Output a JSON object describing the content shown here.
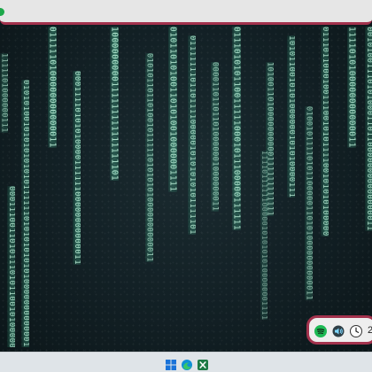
{
  "wallpaper": {
    "name": "binary-rain",
    "text_color": "#bff5dd",
    "glow_color": "#5fe0b0",
    "columns": [
      {
        "text": "0111110100000000000011"
      },
      {
        "text": "0101010010101010101011111101010101010100000000000011"
      },
      {
        "text": "1111101000000111"
      },
      {
        "text": "0001111010101000011111100000000000011"
      },
      {
        "text": "1000000000111111111111111101"
      },
      {
        "text": "010101101101001011111010101010000000000011"
      },
      {
        "text": "010110101001101010010000001111"
      },
      {
        "text": "01111111011011110000010101010101111101"
      },
      {
        "text": "000011011011010000001000000011"
      },
      {
        "text": "0111010101100111110001011100000111111"
      },
      {
        "text": "1010011010000000000111111111111"
      },
      {
        "text": "111101111110000010101010100000001111"
      },
      {
        "text": "1010110010101000000101010000111"
      },
      {
        "text": "010010111101011000001101010000000000011"
      },
      {
        "text": "0111011000100111001010111100101010100000"
      },
      {
        "text": "1111010100000000000011"
      },
      {
        "text": "001010011101010001101100000000000000011"
      },
      {
        "text": "000111001101011101011001010000000011"
      }
    ]
  },
  "top_bar": {
    "accent_color": "#a3324d",
    "indicator_color": "#1da84a"
  },
  "tray": {
    "time": "2",
    "icons": [
      "spotify-icon",
      "volume-icon",
      "clock-icon"
    ]
  },
  "taskbar": {
    "icons": [
      "windows-start-icon",
      "edge-browser-icon",
      "excel-icon"
    ]
  }
}
